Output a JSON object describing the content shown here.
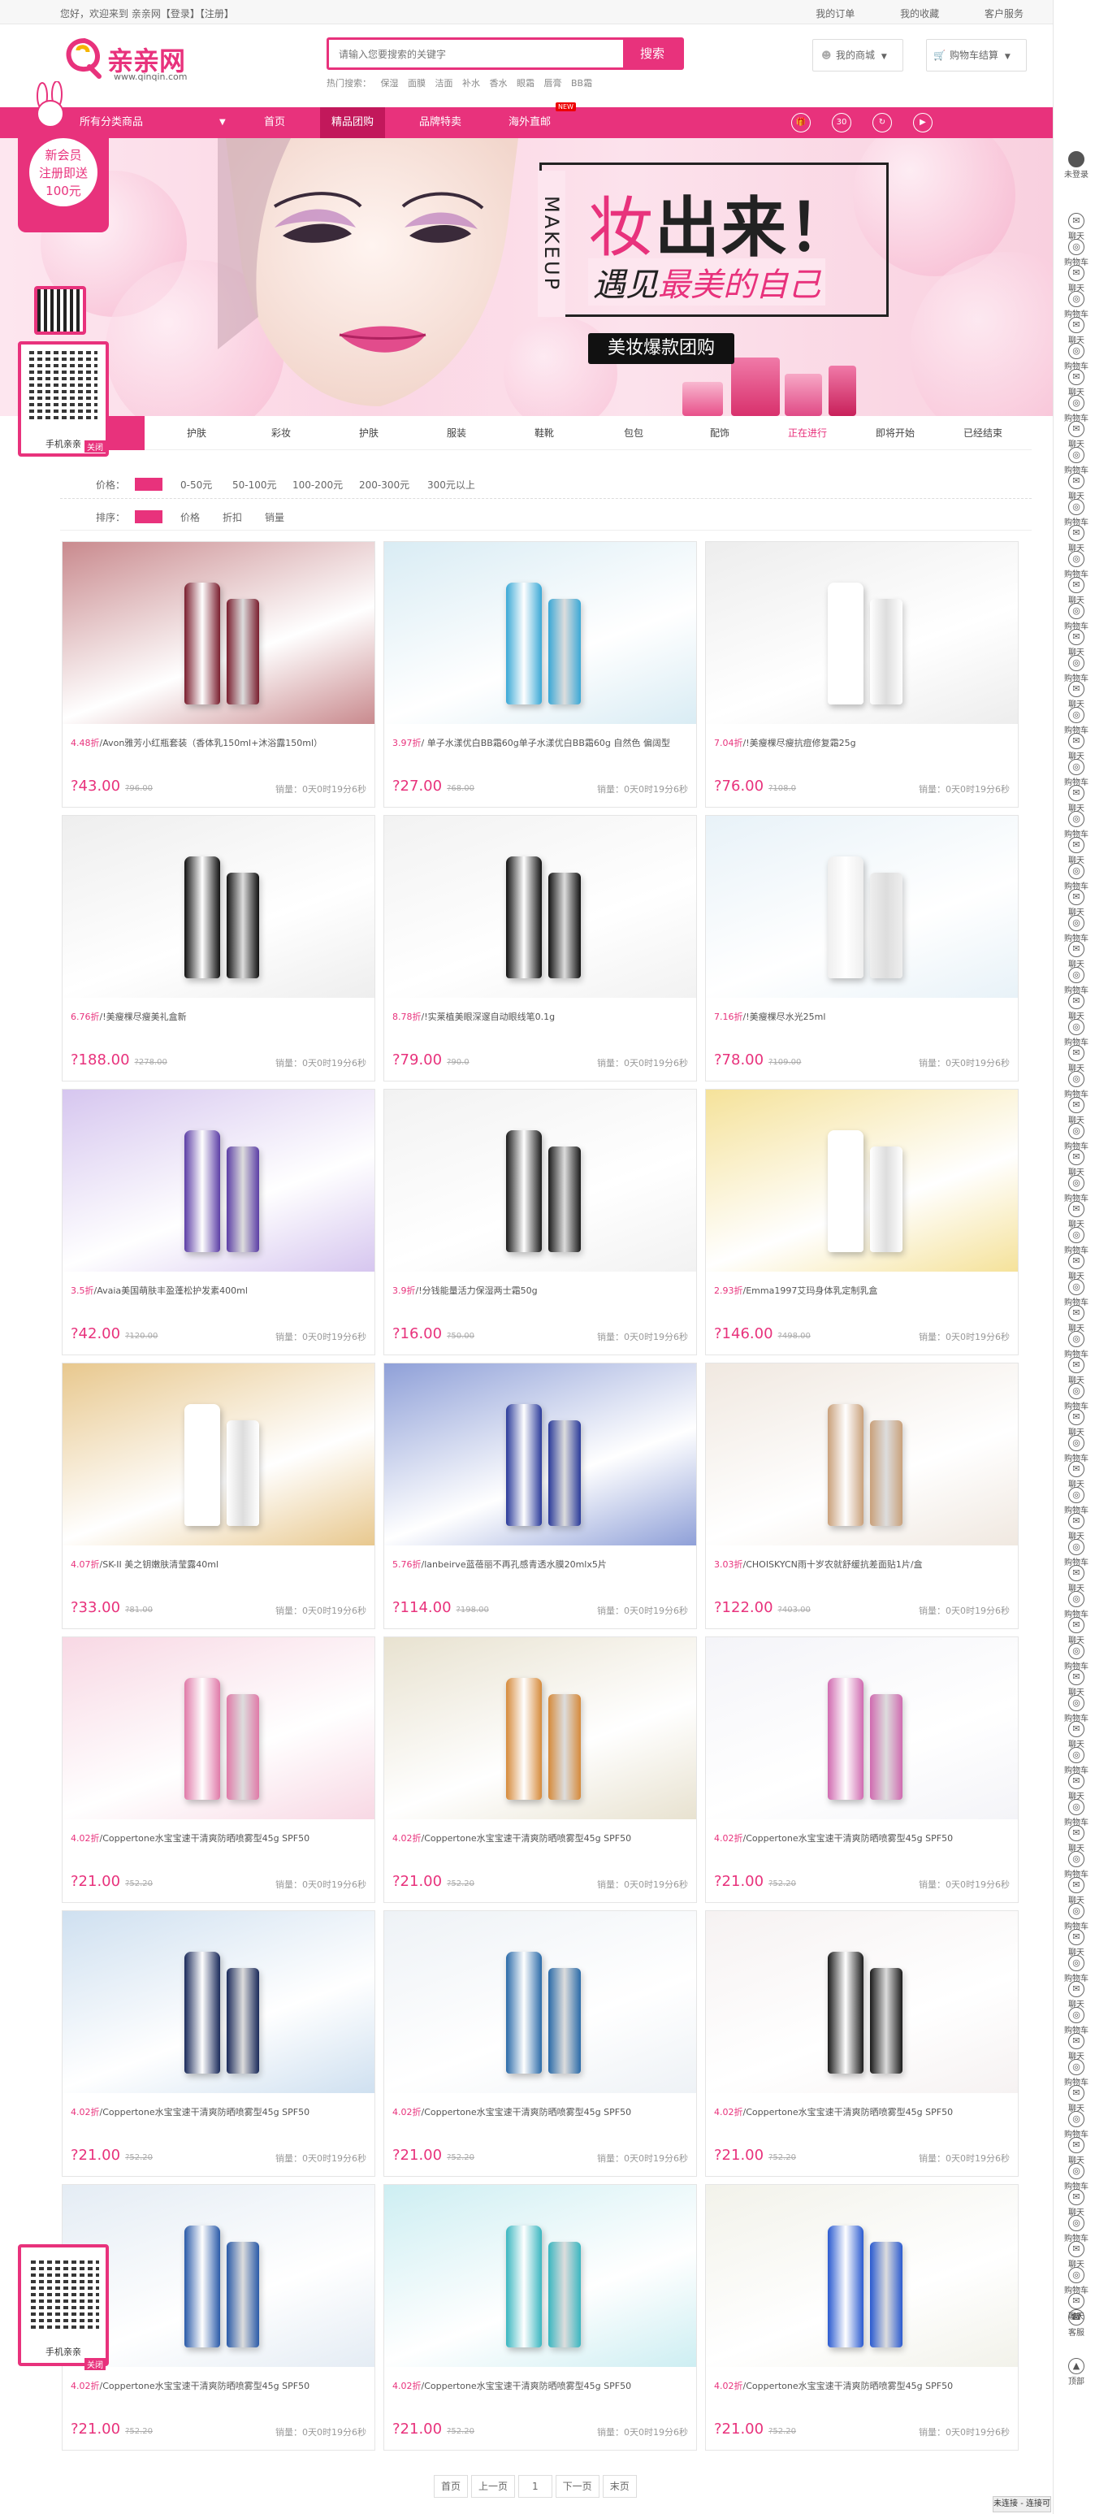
{
  "topbar": {
    "welcome": "您好，欢迎来到 亲亲网【登录】【注册】",
    "links": [
      "我的订单",
      "我的收藏",
      "客户服务"
    ]
  },
  "header": {
    "logo_text": "亲亲网",
    "logo_url_text": "www.qinqin.com",
    "search_placeholder": "请输入您要搜索的关键字",
    "search_button": "搜索",
    "hot_label": "热门搜索：",
    "hot_words": [
      "保湿",
      "面膜",
      "洁面",
      "补水",
      "香水",
      "眼霜",
      "唇膏",
      "BB霜"
    ],
    "my_mall": "我的商城",
    "cart": "购物车结算"
  },
  "nav": {
    "category": "所有分类商品",
    "items": [
      "首页",
      "精品团购",
      "品牌特卖",
      "海外直邮"
    ],
    "new_badge": "NEW",
    "active_index": 1,
    "icon_labels": [
      "",
      "30",
      "",
      ""
    ]
  },
  "banner": {
    "vertical_text": "MAKEUP",
    "headline_pink": "妆",
    "headline_black": "出来！",
    "sub_black": "遇见",
    "sub_pink": "最美的自己",
    "tag": "美妆爆款团购",
    "promo": [
      "新会员",
      "注册即送",
      "100元"
    ],
    "qr_label": "手机亲亲",
    "close_label": "关闭"
  },
  "tabs": {
    "items": [
      "",
      "护肤",
      "彩妆",
      "护肤",
      "服装",
      "鞋靴",
      "包包",
      "配饰",
      "正在进行",
      "即将开始",
      "已经结束"
    ],
    "highlight_index": 8
  },
  "filters": {
    "price_label": "价格：",
    "price_options": [
      "0-50元",
      "50-100元",
      "100-200元",
      "200-300元",
      "300元以上"
    ],
    "sort_label": "排序：",
    "sort_options": [
      "价格",
      "折扣",
      "销量"
    ]
  },
  "products": [
    {
      "discount": "4.48折",
      "title": "/Avon雅芳小红瓶套装（香体乳150ml+沐浴露150ml）",
      "price": "?43.00",
      "old": "?96.00",
      "sales": "销量：0天0时19分6秒",
      "colors": [
        "#c98a8e",
        "#7a1e2e"
      ]
    },
    {
      "discount": "3.97折",
      "title": "/ 单子水漾优白BB霜60g单子水漾优白BB霜60g 自然色 偏阔型",
      "price": "?27.00",
      "old": "?68.00",
      "sales": "销量：0天0时19分6秒",
      "colors": [
        "#d9ecf4",
        "#3aa8d6"
      ]
    },
    {
      "discount": "7.04折",
      "title": "/!美瘦棵尽瘦抗痘修复霜25g",
      "price": "?76.00",
      "old": "?108.0",
      "sales": "销量：0天0时19分6秒",
      "colors": [
        "#ededed",
        "#ffffff"
      ]
    },
    {
      "discount": "6.76折",
      "title": "/!美瘦棵尽瘦美礼盒新",
      "price": "?188.00",
      "old": "?278.00",
      "sales": "销量：0天0时19分6秒",
      "colors": [
        "#eeeeee",
        "#111111"
      ]
    },
    {
      "discount": "8.78折",
      "title": "/!实莱植美眼深邃自动眼线笔0.1g",
      "price": "?79.00",
      "old": "?90.0",
      "sales": "销量：0天0时19分6秒",
      "colors": [
        "#f2f2f2",
        "#111111"
      ]
    },
    {
      "discount": "7.16折",
      "title": "/!美瘦棵尽水光25ml",
      "price": "?78.00",
      "old": "?109.00",
      "sales": "销量：0天0时19分6秒",
      "colors": [
        "#e8f2f8",
        "#eeeeee"
      ]
    },
    {
      "discount": "3.5折",
      "title": "/Avaia美国萌肤丰盈蓬松护发素400ml",
      "price": "?42.00",
      "old": "?120.00",
      "sales": "销量：0天0时19分6秒",
      "colors": [
        "#d6c6ef",
        "#5c3ea6"
      ]
    },
    {
      "discount": "3.9折",
      "title": "/!分钱能量活力保湿两士霜50g",
      "price": "?16.00",
      "old": "?50.00",
      "sales": "销量：0天0时19分6秒",
      "colors": [
        "#f2f2f2",
        "#1a1a1a"
      ]
    },
    {
      "discount": "2.93折",
      "title": "/Emma1997艾玛身体乳定制乳盒",
      "price": "?146.00",
      "old": "?498.00",
      "sales": "销量：0天0时19分6秒",
      "colors": [
        "#f5e29a",
        "#ffffff"
      ]
    },
    {
      "discount": "4.07折",
      "title": "/SK-II 美之钥嫩肤清莹露40ml",
      "price": "?33.00",
      "old": "?81.00",
      "sales": "销量：0天0时19分6秒",
      "colors": [
        "#e8c88e",
        "#ffffff"
      ]
    },
    {
      "discount": "5.76折",
      "title": "/lanbeirve蓝蓓丽不再孔感青透水膜20mlx5片",
      "price": "?114.00",
      "old": "?198.00",
      "sales": "销量：0天0时19分6秒",
      "colors": [
        "#8fa0d8",
        "#2a3a9a"
      ]
    },
    {
      "discount": "3.03折",
      "title": "/CHOISKYCN雨十岁农就舒缓抗差面贴1片/盒",
      "price": "?122.00",
      "old": "?403.00",
      "sales": "销量：0天0时19分6秒",
      "colors": [
        "#f0e8e0",
        "#c9a07a"
      ]
    },
    {
      "discount": "4.02折",
      "title": "/Coppertone水宝宝速干清爽防晒喷雾型45g SPF50",
      "price": "?21.00",
      "old": "?52.20",
      "sales": "销量：0天0时19分6秒",
      "colors": [
        "#f8d8e4",
        "#e07aa8"
      ]
    },
    {
      "discount": "4.02折",
      "title": "/Coppertone水宝宝速干清爽防晒喷雾型45g SPF50",
      "price": "?21.00",
      "old": "?52.20",
      "sales": "销量：0天0时19分6秒",
      "colors": [
        "#e8e2d0",
        "#d68a3a"
      ]
    },
    {
      "discount": "4.02折",
      "title": "/Coppertone水宝宝速干清爽防晒喷雾型45g SPF50",
      "price": "?21.00",
      "old": "?52.20",
      "sales": "销量：0天0时19分6秒",
      "colors": [
        "#f4f4f8",
        "#d06ab0"
      ]
    },
    {
      "discount": "4.02折",
      "title": "/Coppertone水宝宝速干清爽防晒喷雾型45g SPF50",
      "price": "?21.00",
      "old": "?52.20",
      "sales": "销量：0天0时19分6秒",
      "colors": [
        "#cfe0f0",
        "#1a2a5a"
      ]
    },
    {
      "discount": "4.02折",
      "title": "/Coppertone水宝宝速干清爽防晒喷雾型45g SPF50",
      "price": "?21.00",
      "old": "?52.20",
      "sales": "销量：0天0时19分6秒",
      "colors": [
        "#eef2f6",
        "#2a6aa8"
      ]
    },
    {
      "discount": "4.02折",
      "title": "/Coppertone水宝宝速干清爽防晒喷雾型45g SPF50",
      "price": "?21.00",
      "old": "?52.20",
      "sales": "销量：0天0时19分6秒",
      "colors": [
        "#f6f2f2",
        "#1a1a1a"
      ]
    },
    {
      "discount": "4.02折",
      "title": "/Coppertone水宝宝速干清爽防晒喷雾型45g SPF50",
      "price": "?21.00",
      "old": "?52.20",
      "sales": "销量：0天0时19分6秒",
      "colors": [
        "#e4ecf4",
        "#2a5aa8"
      ]
    },
    {
      "discount": "4.02折",
      "title": "/Coppertone水宝宝速干清爽防晒喷雾型45g SPF50",
      "price": "?21.00",
      "old": "?52.20",
      "sales": "销量：0天0时19分6秒",
      "colors": [
        "#cdeef2",
        "#3ab6c0"
      ]
    },
    {
      "discount": "4.02折",
      "title": "/Coppertone水宝宝速干清爽防晒喷雾型45g SPF50",
      "price": "?21.00",
      "old": "?52.20",
      "sales": "销量：0天0时19分6秒",
      "colors": [
        "#f2f2ea",
        "#2a5ad0"
      ]
    }
  ],
  "pager": [
    "首页",
    "上一页",
    "1",
    "下一页",
    "末页"
  ],
  "rail": {
    "user": "未登录",
    "items": [
      "聊天",
      "购物车"
    ],
    "service": "客服",
    "top": "顶部"
  },
  "status": "未连接 - 连接可用"
}
